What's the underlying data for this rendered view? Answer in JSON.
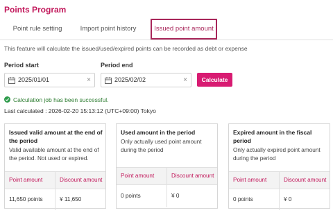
{
  "page": {
    "title": "Points Program"
  },
  "tabs": [
    {
      "label": "Point rule setting"
    },
    {
      "label": "Import point history"
    },
    {
      "label": "Issued point amount"
    }
  ],
  "description": "This feature will calculate the issued/used/expired points can be recorded as debt or expense",
  "period": {
    "start_label": "Period start",
    "start_value": "2025/01/01",
    "end_label": "Period end",
    "end_value": "2025/02/02",
    "clear_glyph": "×"
  },
  "calculate_label": "Calculate",
  "status": {
    "success_text": "Calculation job has been successful.",
    "last_calculated": "Last calculated : 2026-02-20 15:13:12 (UTC+09:00) Tokyo"
  },
  "cards": [
    {
      "title": "Issued valid amount at the end of the period",
      "description": "Valid available amount at the end of the period. Not used or expired.",
      "col_points": "Point amount",
      "col_discount": "Discount amount",
      "points": "11,650 points",
      "discount": "¥ 11,650"
    },
    {
      "title": "Used amount in the period",
      "description": "Only actually used point amount during the period",
      "col_points": "Point amount",
      "col_discount": "Discount amount",
      "points": "0 points",
      "discount": "¥ 0"
    },
    {
      "title": "Expired amount in the fiscal period",
      "description": "Only actually expired point amount during the period",
      "col_points": "Point amount",
      "col_discount": "Discount amount",
      "points": "0 points",
      "discount": "¥ 0"
    }
  ],
  "colors": {
    "brand": "#c2185b",
    "button": "#d81b72",
    "success": "#2e7d32"
  },
  "icons": {
    "date": "calendar-icon",
    "clear": "clear-icon",
    "success": "check-circle-icon"
  }
}
